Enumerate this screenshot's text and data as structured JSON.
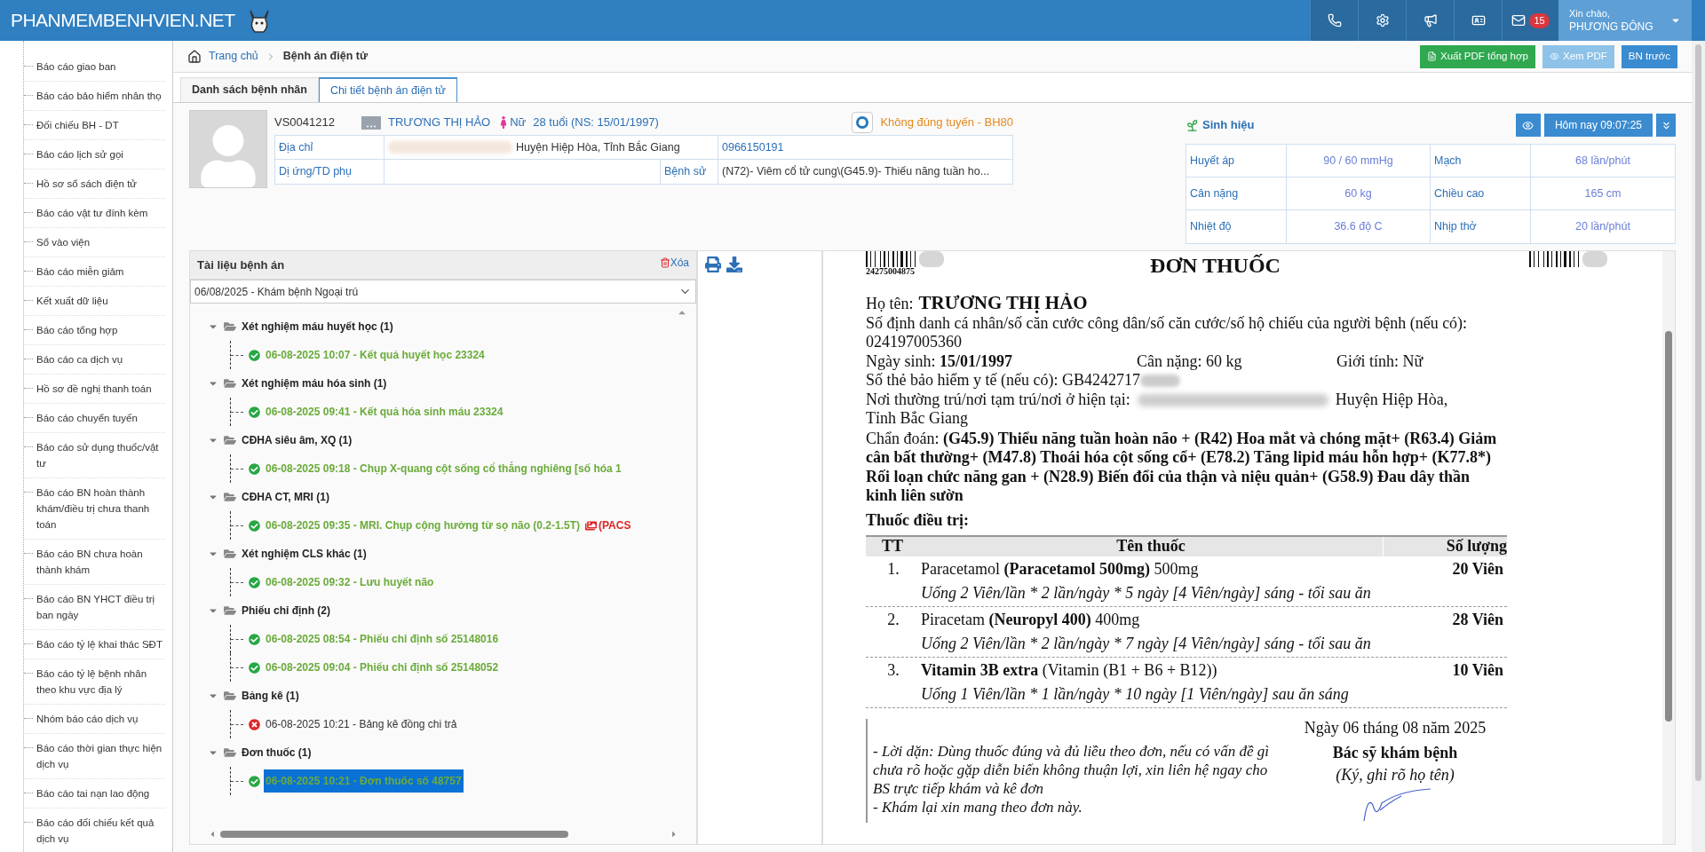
{
  "header": {
    "logo": "PHANMEMBENHVIEN.NET",
    "notification_count": "15",
    "greeting": "Xin chào,",
    "user": "PHƯƠNG ĐÔNG"
  },
  "sidebar": {
    "items": [
      {
        "label": "Báo cáo giao ban"
      },
      {
        "label": "Báo cáo bảo hiểm nhân thọ"
      },
      {
        "label": "Đối chiếu BH - DT"
      },
      {
        "label": "Báo cáo lịch sử gọi"
      },
      {
        "label": "Hồ sơ sổ sách điện tử"
      },
      {
        "label": "Báo cáo vật tư đính kèm"
      },
      {
        "label": "Sổ vào viện"
      },
      {
        "label": "Báo cáo miễn giảm"
      },
      {
        "label": "Kết xuất dữ liệu"
      },
      {
        "label": "Báo cáo tổng hợp"
      },
      {
        "label": "Báo cáo ca dịch vụ"
      },
      {
        "label": "Hồ sơ đề nghị thanh toán"
      },
      {
        "label": "Báo cáo chuyển tuyến"
      },
      {
        "label": "Báo cáo sử dụng thuốc/vật tư"
      },
      {
        "label": "Báo cáo BN hoàn thành khám/điều trị chưa thanh toán"
      },
      {
        "label": "Báo cáo BN chưa hoàn thành khám"
      },
      {
        "label": "Báo cáo BN YHCT điều trị ban ngày"
      },
      {
        "label": "Báo cáo tỷ lệ khai thác SĐT"
      },
      {
        "label": "Báo cáo tỷ lệ bệnh nhân theo khu vực địa lý"
      },
      {
        "label": "Nhóm báo cáo dịch vụ"
      },
      {
        "label": "Báo cáo thời gian thực hiện dịch vụ"
      },
      {
        "label": "Báo cáo tai nạn lao động"
      },
      {
        "label": "Báo cáo đối chiếu kết quả dịch vụ"
      }
    ]
  },
  "breadcrumb": [
    "Trang chủ",
    "Bệnh án điện tử"
  ],
  "actions": [
    {
      "label": "Xuất PDF tổng hợp",
      "kind": "export"
    },
    {
      "label": "Xem PDF",
      "kind": "view"
    },
    {
      "label": "BN trước",
      "kind": "prev"
    }
  ],
  "tabs": [
    {
      "label": "Danh sách bệnh nhân",
      "selected": false
    },
    {
      "label": "Chi tiết bệnh án điện tử",
      "selected": true
    }
  ],
  "patient": {
    "code": "VS0041212",
    "name": "TRƯƠNG THỊ HẢO",
    "gender": "Nữ",
    "age": "28 tuổi (NS: 15/01/1997)",
    "insurance_status": "Không đúng tuyến - BH80",
    "address_label": "Địa chỉ",
    "address": "Huyện Hiệp Hòa, Tỉnh Bắc Giang",
    "phone": "0966150191",
    "allergy_label": "Dị ứng/TD phụ",
    "history_label": "Bệnh sử",
    "history": "(N72)- Viêm cổ tử cung\\(G45.9)- Thiếu năng tuần ho..."
  },
  "vitals": {
    "title": "Sinh hiệu",
    "time_button": "Hôm nay 09:07:25",
    "items": [
      {
        "label": "Huyết áp",
        "value": "90 / 60 mmHg"
      },
      {
        "label": "Mạch",
        "value": "68 lần/phút"
      },
      {
        "label": "Cân nặng",
        "value": "60 kg"
      },
      {
        "label": "Chiều cao",
        "value": "165 cm"
      },
      {
        "label": "Nhiệt độ",
        "value": "36.6 độ C"
      },
      {
        "label": "Nhịp thở",
        "value": "20 lần/phút"
      }
    ]
  },
  "documents": {
    "title": "Tài liệu bệnh án",
    "delete": "Xóa",
    "visit": "06/08/2025 - Khám bệnh Ngoại trú",
    "groups": [
      {
        "label": "Xét nghiệm máu huyết học (1)",
        "expanded": true,
        "children": [
          {
            "label": "06-08-2025 10:07 - Kết quả huyết học 23324",
            "failed": false,
            "selected": false
          }
        ]
      },
      {
        "label": "Xét nghiệm máu hóa sinh (1)",
        "expanded": true,
        "children": [
          {
            "label": "06-08-2025 09:41 - Kết quả hóa sinh máu 23324",
            "failed": false,
            "selected": false
          }
        ]
      },
      {
        "label": "CĐHA siêu âm, XQ (1)",
        "expanded": true,
        "children": [
          {
            "label": "06-08-2025 09:18 - Chụp X-quang cột sống cổ thẳng nghiêng [số hóa 1",
            "failed": false,
            "selected": false
          }
        ]
      },
      {
        "label": "CĐHA CT, MRI (1)",
        "expanded": true,
        "children": [
          {
            "label": "06-08-2025 09:35 - MRI. Chụp cộng hưởng từ sọ não (0.2-1.5T)",
            "failed": false,
            "selected": false,
            "pacs": "(PACS"
          }
        ]
      },
      {
        "label": "Xét nghiệm CLS khác (1)",
        "expanded": true,
        "children": [
          {
            "label": "06-08-2025 09:32 - Lưu huyết não",
            "failed": false,
            "selected": false
          }
        ]
      },
      {
        "label": "Phiếu chỉ định (2)",
        "expanded": true,
        "children": [
          {
            "label": "06-08-2025 08:54 - Phiếu chỉ định số 25148016",
            "failed": false,
            "selected": false
          },
          {
            "label": "06-08-2025 09:04 - Phiếu chỉ định số 25148052",
            "failed": false,
            "selected": false
          }
        ]
      },
      {
        "label": "Bảng kê (1)",
        "expanded": true,
        "children": [
          {
            "label": "06-08-2025 10:21 - Bảng kê đồng chi trả",
            "failed": true,
            "selected": false
          }
        ]
      },
      {
        "label": "Đơn thuốc (1)",
        "expanded": true,
        "children": [
          {
            "label": "06-08-2025 10:21 - Đơn thuốc số 48757",
            "failed": false,
            "selected": true
          }
        ]
      }
    ]
  },
  "prescription": {
    "barcode_number": "24275004875",
    "title": "ĐƠN THUỐC",
    "name_label": "Họ tên:",
    "name": "TRƯƠNG THỊ HẢO",
    "id_line": "Số định danh cá nhân/số căn cước công dân/số căn cước/số hộ chiếu của người bệnh (nếu có): 024197005360",
    "dob": "Ngày sinh: **15/01/1997**",
    "weight": "Cân nặng: 60 kg",
    "sex": "Giới tính: Nữ",
    "insurance": "Số thẻ bảo hiểm y tế (nếu có): GB4242717",
    "address_label": "Nơi thường trú/nơi tạm trú/nơi ở hiện tại:",
    "address": [
      "Huyện Hiệp Hòa,",
      "Tỉnh Bắc Giang"
    ],
    "diagnosis": "Chẩn đoán: **(G45.9) Thiểu năng tuần hoàn não + (R42) Hoa mắt và chóng mặt+ (R63.4) Giảm cân bất thường+ (M47.8) Thoái hóa cột sống cổ+ (E78.2) Tăng lipid máu hỗn hợp+ (K77.8*) Rối loạn chức năng gan + (N28.9) Biến đổi của thận và niệu quản+ (G58.9) Đau dây thần kinh liên sườn**",
    "treatment_title": "Thuốc điều trị:",
    "columns": [
      "TT",
      "Tên thuốc",
      "Số lượng"
    ],
    "drugs": [
      {
        "index": "1.",
        "name": "Paracetamol **(Paracetamol 500mg)** 500mg",
        "usage": "Uống 2 Viên/lần * 2 lần/ngày * 5 ngày [4 Viên/ngày] sáng - tối sau ăn",
        "quantity": "20 Viên"
      },
      {
        "index": "2.",
        "name": "Piracetam **(Neuropyl 400)** 400mg",
        "usage": "Uống 2 Viên/lần * 2 lần/ngày * 7 ngày [4 Viên/ngày] sáng - tối sau ăn",
        "quantity": "28 Viên"
      },
      {
        "index": "3.",
        "name": "**Vitamin 3B extra** (Vitamin (B1 + B6 + B12))",
        "usage": "Uống 1 Viên/lần * 1 lần/ngày * 10 ngày [1 Viên/ngày] sau ăn sáng",
        "quantity": "10 Viên"
      }
    ],
    "date": "Ngày 06 tháng 08 năm 2025",
    "signer": "Bác sỹ khám bệnh",
    "sign_hint": "(Ký, ghi rõ họ tên)",
    "notes": [
      "- Lời dặn: Dùng thuốc đúng và đủ liều theo đơn, nếu có vấn đề gì chưa rõ hoặc gặp diễn biến không thuận lợi, xin liên hệ ngay cho BS trực tiếp khám và kê đơn",
      "- Khám lại xin mang theo đơn này."
    ]
  }
}
